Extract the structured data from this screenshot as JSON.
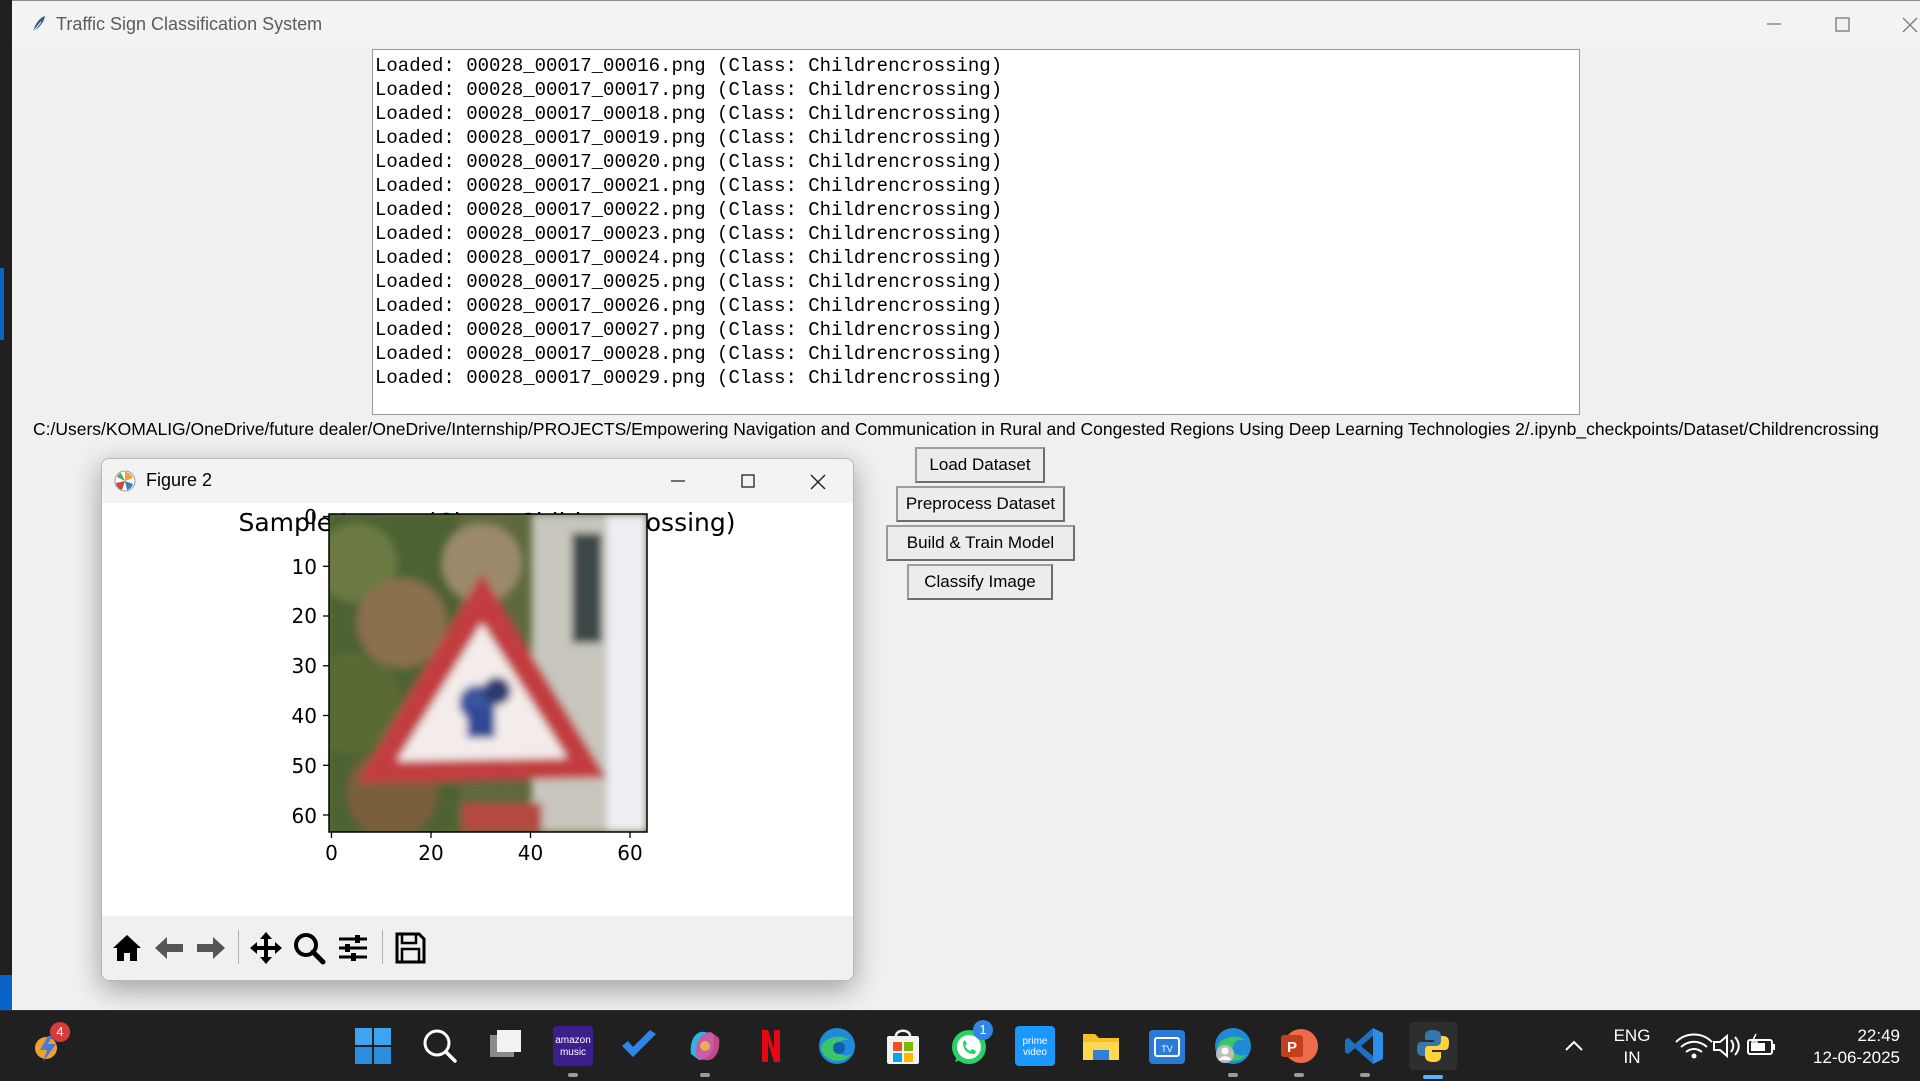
{
  "main_window": {
    "title": "Traffic Sign Classification System",
    "log_lines": [
      "Loaded: 00028_00017_00016.png (Class: Childrencrossing)",
      "Loaded: 00028_00017_00017.png (Class: Childrencrossing)",
      "Loaded: 00028_00017_00018.png (Class: Childrencrossing)",
      "Loaded: 00028_00017_00019.png (Class: Childrencrossing)",
      "Loaded: 00028_00017_00020.png (Class: Childrencrossing)",
      "Loaded: 00028_00017_00021.png (Class: Childrencrossing)",
      "Loaded: 00028_00017_00022.png (Class: Childrencrossing)",
      "Loaded: 00028_00017_00023.png (Class: Childrencrossing)",
      "Loaded: 00028_00017_00024.png (Class: Childrencrossing)",
      "Loaded: 00028_00017_00025.png (Class: Childrencrossing)",
      "Loaded: 00028_00017_00026.png (Class: Childrencrossing)",
      "Loaded: 00028_00017_00027.png (Class: Childrencrossing)",
      "Loaded: 00028_00017_00028.png (Class: Childrencrossing)",
      "Loaded: 00028_00017_00029.png (Class: Childrencrossing)"
    ],
    "path_label": "C:/Users/KOMALIG/OneDrive/future dealer/OneDrive/Internship/PROJECTS/Empowering Navigation and Communication in Rural and Congested Regions Using Deep Learning Technologies 2/.ipynb_checkpoints/Dataset/Childrencrossing",
    "buttons": {
      "load": "Load Dataset",
      "preprocess": "Preprocess Dataset",
      "build": "Build & Train Model",
      "classify": "Classify Image"
    }
  },
  "figure_window": {
    "title": "Figure 2",
    "plot_title": "Sample Image (Class: Childrencrossing)",
    "x_ticks": [
      "0",
      "20",
      "40",
      "60"
    ],
    "y_ticks": [
      "0",
      "10",
      "20",
      "30",
      "40",
      "50",
      "60"
    ],
    "toolbar": [
      "home-icon",
      "back-icon",
      "forward-icon",
      "pan-icon",
      "zoom-icon",
      "configure-icon",
      "save-icon"
    ]
  },
  "taskbar": {
    "widgets_badge": "4",
    "whatsapp_badge": "1",
    "language_top": "ENG",
    "language_bottom": "IN",
    "time": "22:49",
    "date": "12-06-2025",
    "amazon_music_label_top": "amazon",
    "amazon_music_label_bottom": "music",
    "prime_label_top": "prime",
    "prime_label_bottom": "video"
  },
  "colors": {
    "taskbar": "#202020",
    "window_bg": "#f0f0f0",
    "accent_blue": "#0a64c8",
    "sign_red": "#b8383c"
  }
}
